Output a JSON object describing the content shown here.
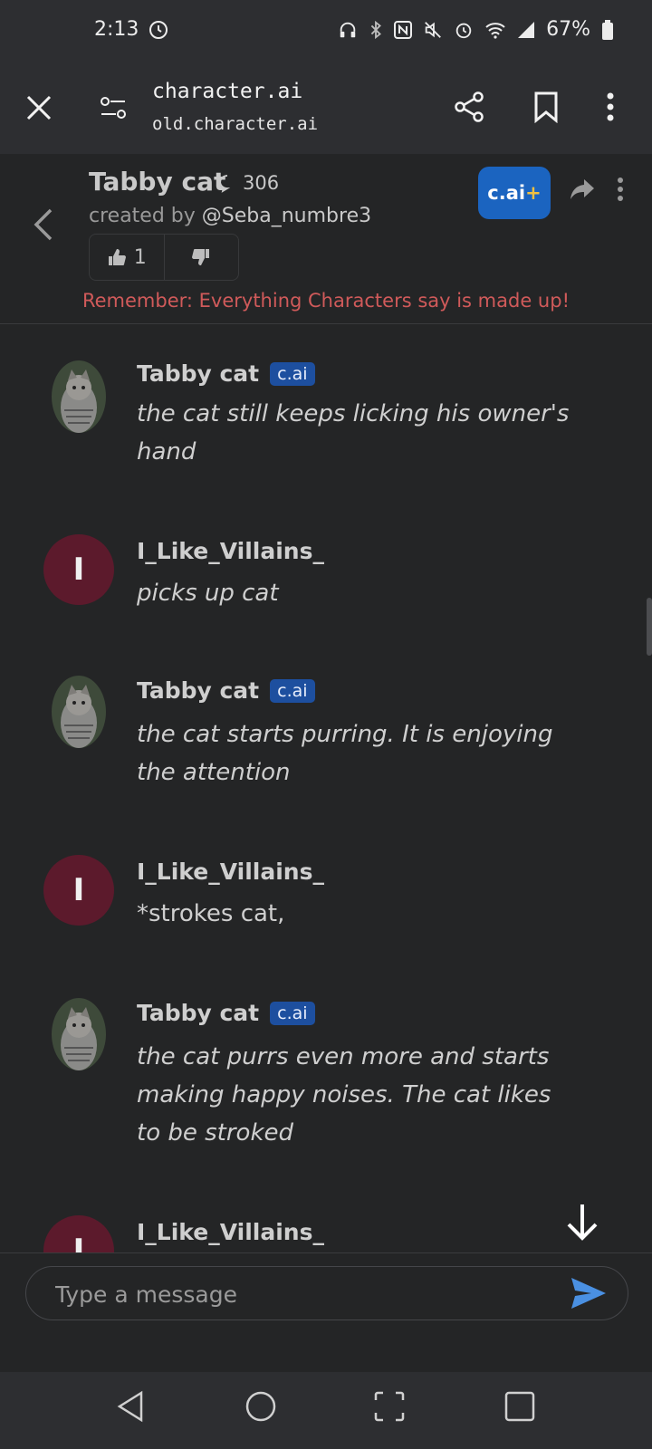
{
  "status": {
    "time": "2:13",
    "battery": "67%"
  },
  "browser": {
    "title": "character.ai",
    "subtitle": "old.character.ai"
  },
  "character": {
    "name": "Tabby cat",
    "chat_count": "306",
    "created_by_prefix": "created by",
    "creator": "@Seba_numbre3",
    "likes": "1",
    "plus_label_main": "c.ai",
    "plus_label_plus": "+",
    "disclaimer": "Remember: Everything Characters say is made up!"
  },
  "messages": [
    {
      "sender": "Tabby cat",
      "tag": "c.ai",
      "text": "the cat still keeps licking his owner's hand"
    },
    {
      "sender": "I_Like_Villains_",
      "initial": "I",
      "text": "picks up cat"
    },
    {
      "sender": "Tabby cat",
      "tag": "c.ai",
      "text": "the cat starts purring. It is enjoying the attention"
    },
    {
      "sender": "I_Like_Villains_",
      "initial": "I",
      "text": "*strokes cat,"
    },
    {
      "sender": "Tabby cat",
      "tag": "c.ai",
      "text": "the cat purrs even more and starts making happy noises. The cat likes to be stroked"
    },
    {
      "sender": "I_Like_Villains_",
      "initial": "I",
      "text": ""
    }
  ],
  "composer": {
    "placeholder": "Type a message"
  },
  "colors": {
    "accent": "#1b64c0",
    "user_avatar": "#5c1a2c",
    "disclaimer": "#d05a5a",
    "send": "#4a90e2"
  }
}
